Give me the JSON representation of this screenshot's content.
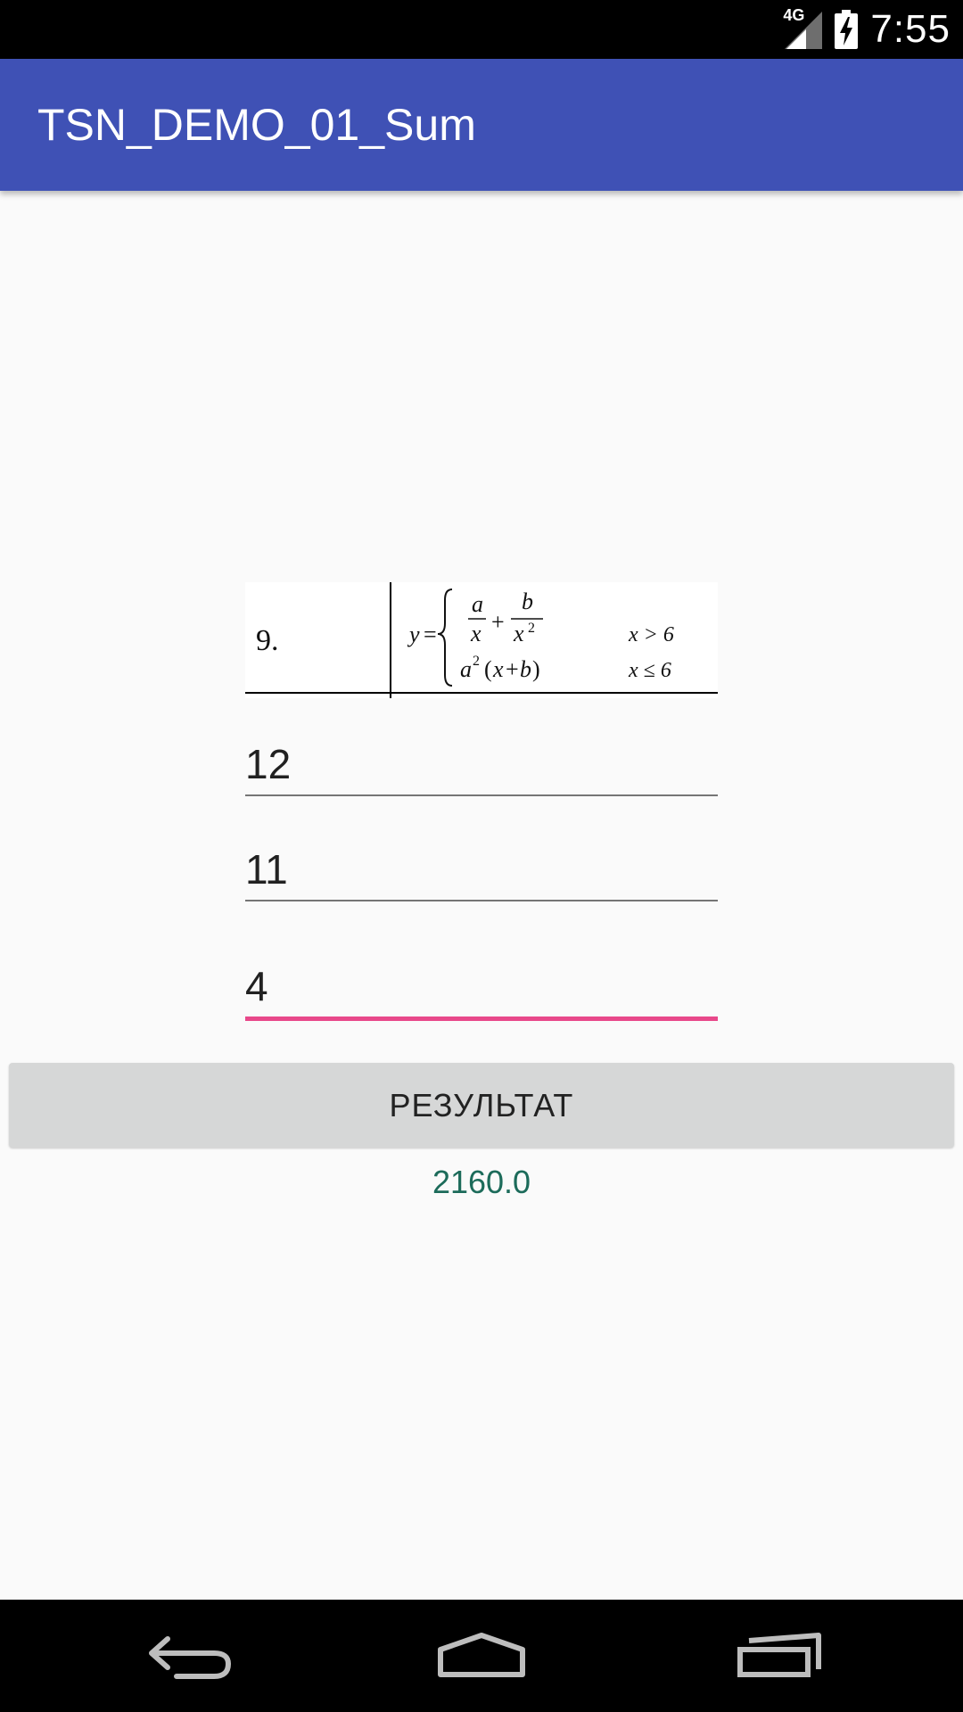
{
  "status_bar": {
    "network_label": "4G",
    "time": "7:55"
  },
  "app_bar": {
    "title": "TSN_DEMO_01_Sum"
  },
  "task_image": {
    "number": "9.",
    "cond_top": "x > 6",
    "cond_bottom": "x ≤ 6"
  },
  "inputs": [
    {
      "value": "12"
    },
    {
      "value": "11"
    },
    {
      "value": "4"
    }
  ],
  "button": {
    "label": "РЕЗУЛЬТАТ"
  },
  "result": {
    "value": "2160.0"
  },
  "colors": {
    "app_bar": "#3f51b5",
    "accent": "#e8488a",
    "result_text": "#1c6b5a"
  },
  "nav_bar": {
    "icons": [
      "back-icon",
      "home-icon",
      "recents-icon"
    ]
  }
}
